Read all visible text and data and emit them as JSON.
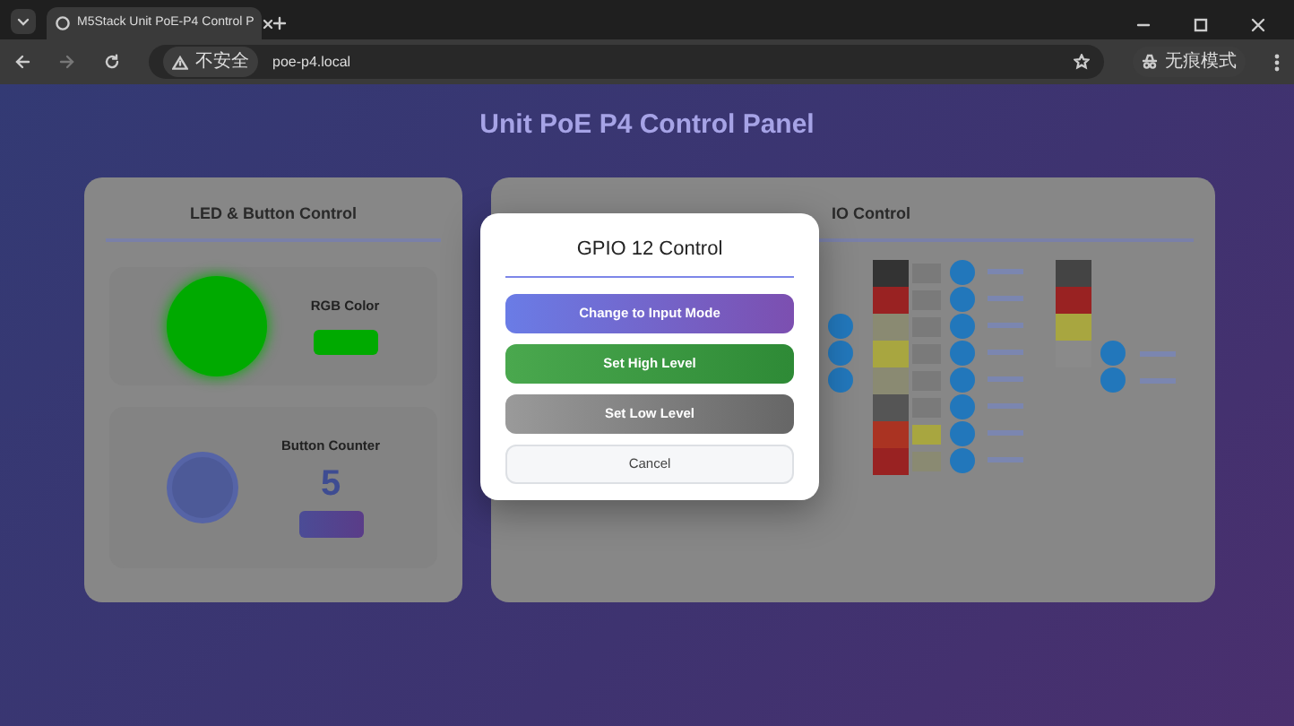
{
  "browser": {
    "tab": {
      "title": "M5Stack Unit PoE-P4 Control P",
      "selected": true
    },
    "address": {
      "security": "不安全",
      "url": "poe-p4.local"
    },
    "profile": "无痕模式"
  },
  "page": {
    "title": "Unit PoE P4 Control Panel",
    "led_card": {
      "title": "LED & Button Control",
      "rgb_label": "RGB Color",
      "counter_label": "Button Counter",
      "counter": "5"
    },
    "gpio_card": {
      "title": "IO Control"
    }
  },
  "dialog": {
    "title": "GPIO 12 Control",
    "buttons": [
      {
        "label": "Change to Input Mode",
        "kind": "mode"
      },
      {
        "label": "Set High Level",
        "kind": "high"
      },
      {
        "label": "Set Low Level",
        "kind": "low"
      },
      {
        "label": "Cancel",
        "kind": "cancel"
      }
    ]
  }
}
